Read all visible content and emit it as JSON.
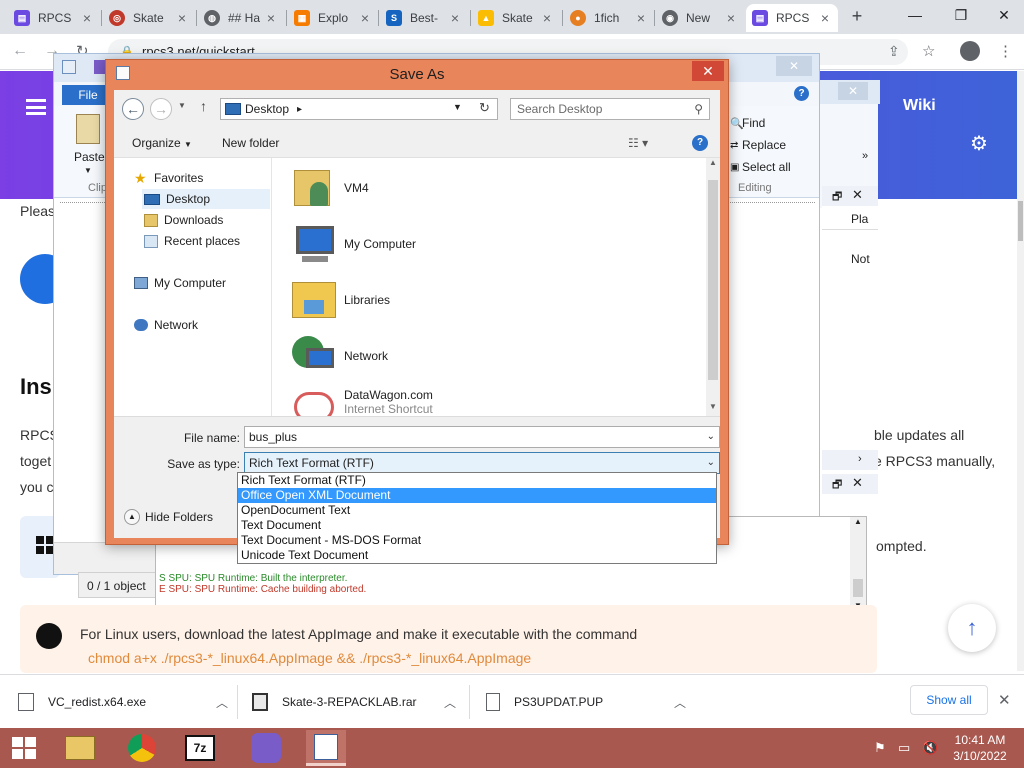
{
  "browser": {
    "tabs": [
      {
        "label": "RPCS",
        "icon": "rpcs3-icon"
      },
      {
        "label": "Skate",
        "icon": "target-icon"
      },
      {
        "label": "## Ha",
        "icon": "globe-icon"
      },
      {
        "label": "Explo",
        "icon": "explore-icon"
      },
      {
        "label": "Best-",
        "icon": "s-logo-icon"
      },
      {
        "label": "Skate",
        "icon": "drive-icon"
      },
      {
        "label": "1fich",
        "icon": "fichier-icon"
      },
      {
        "label": "New",
        "icon": "chrome-icon"
      },
      {
        "label": "RPCS",
        "icon": "rpcs3-icon"
      }
    ],
    "new_tab": "+",
    "url": "rpcs3.net/quickstart"
  },
  "page": {
    "wiki_label": "Wiki",
    "para_lines": [
      "RPCS",
      "toget",
      "you c"
    ],
    "right_lines": [
      "ble updates all",
      "e RPCS3 manually,"
    ],
    "prompted": "ompted.",
    "heading": "Ins",
    "please": "Pleas",
    "linux_text": "For Linux users, download the latest AppImage and make it executable with the command",
    "linux_cmd": "chmod a+x ./rpcs3-*_linux64.AppImage && ./rpcs3-*_linux64.AppImage"
  },
  "wordpad": {
    "file_tab": "File",
    "paste_label": "Paste",
    "clip_label": "Clip",
    "find_label": "Find",
    "replace_label": "Replace",
    "select_all_label": "Select all",
    "editing_label": "Editing"
  },
  "right_panel": {
    "play": "Pla",
    "not": "Not",
    "objects": "0 / 1 object",
    "log_line_1": "S SPU: SPU Runtime: Built the interpreter.",
    "log_line_2": "E SPU: SPU Runtime: Cache building aborted."
  },
  "dialog": {
    "title": "Save As",
    "close": "✕",
    "location": "Desktop",
    "search_placeholder": "Search Desktop",
    "organize": "Organize",
    "new_folder": "New folder",
    "nav": [
      {
        "label": "Favorites",
        "icon": "star-icon"
      },
      {
        "label": "Desktop",
        "icon": "desktop-icon"
      },
      {
        "label": "Downloads",
        "icon": "downloads-folder-icon"
      },
      {
        "label": "Recent places",
        "icon": "recent-places-icon"
      },
      {
        "label": "My Computer",
        "icon": "computer-icon"
      },
      {
        "label": "Network",
        "icon": "network-icon"
      }
    ],
    "files": [
      {
        "label": "VM4",
        "sub": "",
        "icon": "user-folder-icon"
      },
      {
        "label": "My Computer",
        "sub": "",
        "icon": "computer-icon"
      },
      {
        "label": "Libraries",
        "sub": "",
        "icon": "libraries-folder-icon"
      },
      {
        "label": "Network",
        "sub": "",
        "icon": "network-globe-icon"
      },
      {
        "label": "DataWagon.com",
        "sub": "Internet Shortcut",
        "icon": "shortcut-icon"
      }
    ],
    "file_name_label": "File name:",
    "file_name_value": "bus_plus",
    "save_type_label": "Save as type:",
    "save_type_value": "Rich Text Format (RTF)",
    "hide_folders": "Hide Folders",
    "type_options": [
      "Rich Text Format (RTF)",
      "Office Open XML Document",
      "OpenDocument Text",
      "Text Document",
      "Text Document - MS-DOS Format",
      "Unicode Text Document"
    ],
    "highlighted_option_index": 1
  },
  "downloads": [
    {
      "name": "VC_redist.x64.exe",
      "icon": "installer-icon"
    },
    {
      "name": "Skate-3-REPACKLAB.rar",
      "icon": "rar-archive-icon"
    },
    {
      "name": "PS3UPDAT.PUP",
      "icon": "file-icon"
    }
  ],
  "downloads_show_all": "Show all",
  "taskbar": {
    "time": "10:41 AM",
    "date": "3/10/2022"
  },
  "colors": {
    "dialog_frame": "#e9855a",
    "taskbar": "#a8584f",
    "site_header": "#6a4ae0",
    "selection": "#3399ff"
  }
}
